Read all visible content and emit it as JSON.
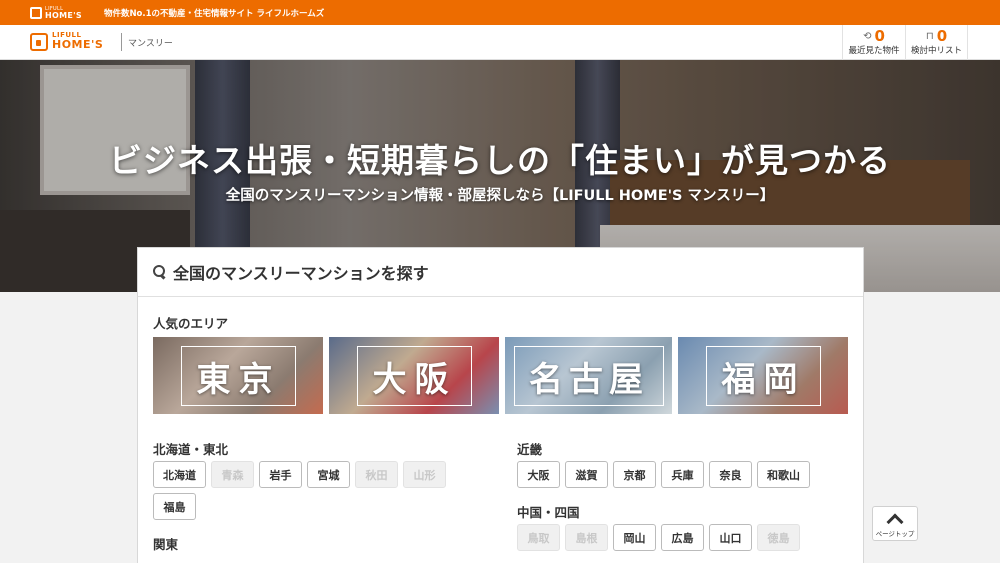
{
  "topbar": {
    "mini_logo_top": "LIFULL",
    "mini_logo_bottom": "HOME'S",
    "tagline": "物件数No.1の不動産・住宅情報サイト ライフルホームズ"
  },
  "header": {
    "logo_top": "LIFULL",
    "logo_bottom": "HOME'S",
    "section": "マンスリー",
    "recent": {
      "count": "0",
      "label": "最近見た物件",
      "icon": "history-icon"
    },
    "wishlist": {
      "count": "0",
      "label": "検討中リスト",
      "icon": "bookmark-icon"
    }
  },
  "hero": {
    "title": "ビジネス出張・短期暮らしの「住まい」が見つかる",
    "subtitle": "全国のマンスリーマンション情報・部屋探しなら【LIFULL HOME'S マンスリー】"
  },
  "search": {
    "title": "全国のマンスリーマンションを探す",
    "popular_label": "人気のエリア",
    "popular_areas": [
      "東京",
      "大阪",
      "名古屋",
      "福岡"
    ],
    "regions": {
      "hokkaido_tohoku": {
        "title": "北海道・東北",
        "prefs": [
          {
            "name": "北海道",
            "enabled": true
          },
          {
            "name": "青森",
            "enabled": false
          },
          {
            "name": "岩手",
            "enabled": true
          },
          {
            "name": "宮城",
            "enabled": true
          },
          {
            "name": "秋田",
            "enabled": false
          },
          {
            "name": "山形",
            "enabled": false
          },
          {
            "name": "福島",
            "enabled": true
          }
        ]
      },
      "kanto": {
        "title": "関東"
      },
      "kinki": {
        "title": "近畿",
        "prefs": [
          {
            "name": "大阪",
            "enabled": true
          },
          {
            "name": "滋賀",
            "enabled": true
          },
          {
            "name": "京都",
            "enabled": true
          },
          {
            "name": "兵庫",
            "enabled": true
          },
          {
            "name": "奈良",
            "enabled": true
          },
          {
            "name": "和歌山",
            "enabled": true
          }
        ]
      },
      "chugoku_shikoku": {
        "title": "中国・四国",
        "prefs": [
          {
            "name": "鳥取",
            "enabled": false
          },
          {
            "name": "島根",
            "enabled": false
          },
          {
            "name": "岡山",
            "enabled": true
          },
          {
            "name": "広島",
            "enabled": true
          },
          {
            "name": "山口",
            "enabled": true
          },
          {
            "name": "徳島",
            "enabled": false
          }
        ]
      }
    }
  },
  "page_top": {
    "label": "ページトップ"
  },
  "colors": {
    "brand": "#ed6c00",
    "disabled_bg": "#f0f0f0",
    "disabled_text": "#c8c8c8"
  }
}
